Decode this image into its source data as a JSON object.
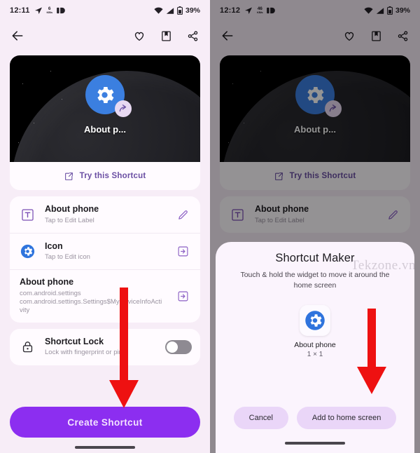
{
  "left_screen": {
    "status_bar": {
      "time": "12:11",
      "network_speed_value": "6",
      "network_speed_unit": "KB/s",
      "battery_percent": "39%",
      "icons": [
        "telegram-send-icon",
        "network-speed-icon",
        "dnd-icon",
        "wifi-icon",
        "signal-icon",
        "battery-icon"
      ]
    },
    "app_bar": {
      "back": "back-arrow-icon",
      "actions": [
        "favorite-heart-icon",
        "bookmark-icon",
        "share-icon"
      ]
    },
    "preview": {
      "label": "About p...",
      "try_label": "Try this Shortcut",
      "try_icon": "open-external-icon"
    },
    "rows": [
      {
        "name": "label-row",
        "lead_icon": "text-label-icon",
        "title": "About phone",
        "subtitle": "Tap to Edit Label",
        "trail_icon": "pencil-edit-icon"
      },
      {
        "name": "icon-row",
        "lead_icon": "gear-settings-icon",
        "title": "Icon",
        "subtitle": "Tap to Edit icon",
        "trail_icon": "open-in-icon"
      },
      {
        "name": "activity-row",
        "lead_icon": "",
        "title": "About phone",
        "subtitle": "com.android.settings\ncom.android.settings.Settings$MyDeviceInfoActivity",
        "trail_icon": "open-in-icon"
      },
      {
        "name": "shortcut-lock-row",
        "lead_icon": "lock-icon",
        "title": "Shortcut Lock",
        "subtitle": "Lock with fingerprint or pin",
        "trail_icon": "toggle-switch-off"
      }
    ],
    "cta_label": "Create Shortcut",
    "accent_purple": "#8c2ef0",
    "link_purple": "#6a4fa3",
    "background": "#f7edf7"
  },
  "right_screen": {
    "status_bar": {
      "time": "12:12",
      "network_speed_value": "46",
      "network_speed_unit": "KB/s",
      "battery_percent": "39%"
    },
    "dialog": {
      "title": "Shortcut Maker",
      "subtitle": "Touch & hold the widget to move it around the home screen",
      "widget_name": "About phone",
      "widget_size": "1 × 1",
      "cancel_label": "Cancel",
      "confirm_label": "Add to home screen"
    },
    "watermark": "Tekzone.vn",
    "scrim_color": "rgba(0,0,0,0.42)"
  },
  "annotations": {
    "arrow_color": "#ee1111",
    "left_arrow_target": "Create Shortcut",
    "right_arrow_target": "Add to home screen"
  }
}
